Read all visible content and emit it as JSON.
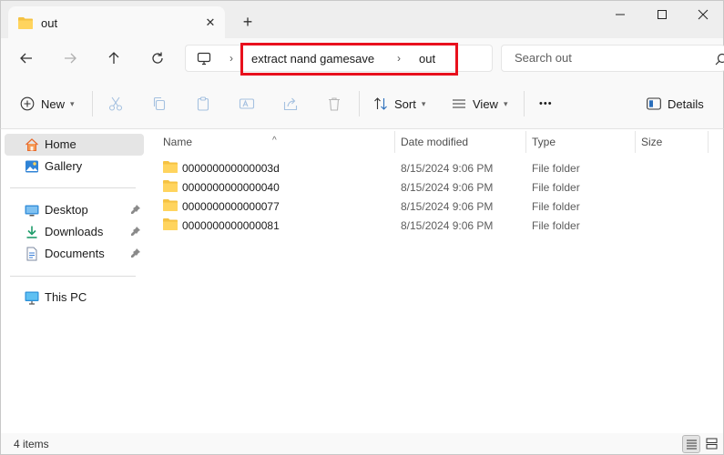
{
  "tab": {
    "title": "out",
    "close_symbol": "✕",
    "new_tab_symbol": "+"
  },
  "address": {
    "crumbs": [
      "extract nand gamesave",
      "out"
    ],
    "separator": "›"
  },
  "search": {
    "placeholder": "Search out"
  },
  "commands": {
    "new": "New",
    "sort": "Sort",
    "view": "View",
    "more": "•••",
    "details": "Details"
  },
  "sidebar": {
    "items": [
      {
        "label": "Home",
        "icon": "home-icon"
      },
      {
        "label": "Gallery",
        "icon": "gallery-icon"
      },
      {
        "label": "Desktop",
        "icon": "desktop-icon",
        "pinned": true
      },
      {
        "label": "Downloads",
        "icon": "downloads-icon",
        "pinned": true
      },
      {
        "label": "Documents",
        "icon": "documents-icon",
        "pinned": true
      },
      {
        "label": "This PC",
        "icon": "this-pc-icon"
      }
    ]
  },
  "table": {
    "columns": {
      "name": "Name",
      "date": "Date modified",
      "type": "Type",
      "size": "Size"
    },
    "sort_indicator": "^",
    "rows": [
      {
        "name": "000000000000003d",
        "date": "8/15/2024 9:06 PM",
        "type": "File folder",
        "size": ""
      },
      {
        "name": "0000000000000040",
        "date": "8/15/2024 9:06 PM",
        "type": "File folder",
        "size": ""
      },
      {
        "name": "0000000000000077",
        "date": "8/15/2024 9:06 PM",
        "type": "File folder",
        "size": ""
      },
      {
        "name": "0000000000000081",
        "date": "8/15/2024 9:06 PM",
        "type": "File folder",
        "size": ""
      }
    ]
  },
  "status": {
    "item_count": "4 items"
  },
  "colors": {
    "highlight_box": "#e8101d",
    "folder": "#f5c242",
    "accent": "#0067c0"
  }
}
